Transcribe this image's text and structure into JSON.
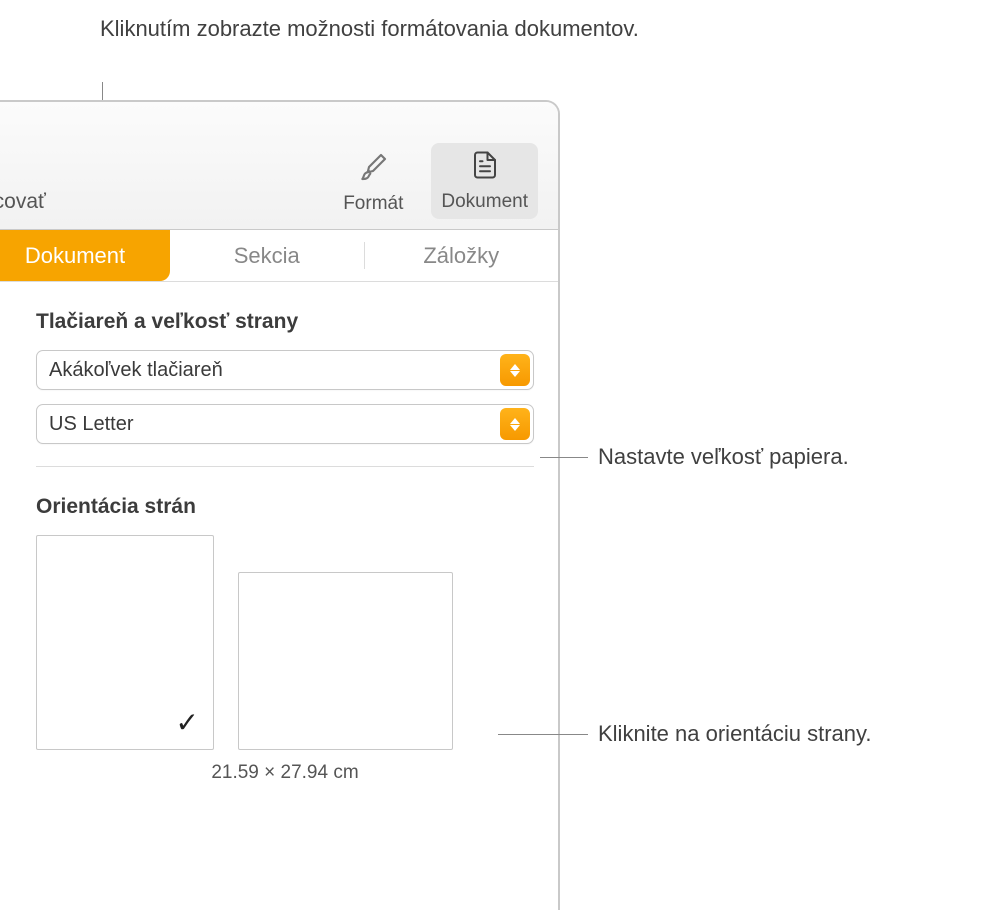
{
  "callouts": {
    "top": "Kliknutím zobrazte možnosti formátovania dokumentov.",
    "paper": "Nastavte veľkosť papiera.",
    "orientation": "Kliknite na orientáciu strany."
  },
  "toolbar": {
    "left_stub": "acovať",
    "format_label": "Formát",
    "document_label": "Dokument"
  },
  "panel_tabs": {
    "document": "Dokument",
    "section": "Sekcia",
    "bookmarks": "Záložky"
  },
  "printer_section": {
    "title": "Tlačiareň a veľkosť strany",
    "printer_value": "Akákoľvek tlačiareň",
    "papersize_value": "US Letter"
  },
  "orientation_section": {
    "title": "Orientácia strán",
    "dimensions": "21.59 × 27.94 cm"
  }
}
